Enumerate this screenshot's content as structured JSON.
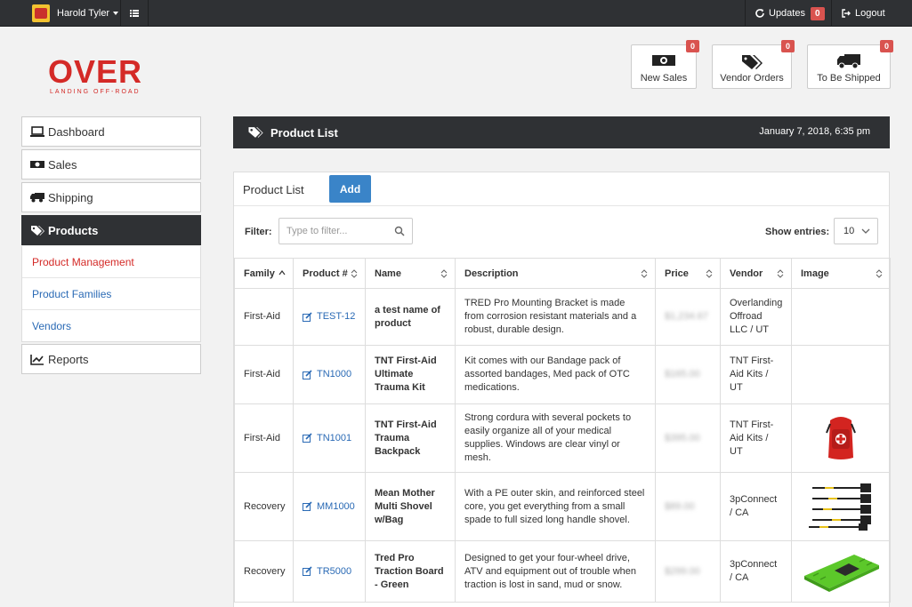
{
  "topbar": {
    "user_name": "Harold Tyler",
    "updates_label": "Updates",
    "updates_count": "0",
    "logout_label": "Logout"
  },
  "logo": {
    "main": "OVER",
    "sub": "LANDING OFF-ROAD"
  },
  "stats": [
    {
      "label": "New Sales",
      "count": "0",
      "icon": "money-icon"
    },
    {
      "label": "Vendor Orders",
      "count": "0",
      "icon": "tags-icon"
    },
    {
      "label": "To Be Shipped",
      "count": "0",
      "icon": "truck-icon"
    }
  ],
  "sidebar": {
    "items": [
      {
        "label": "Dashboard",
        "icon": "laptop-icon"
      },
      {
        "label": "Sales",
        "icon": "money-icon"
      },
      {
        "label": "Shipping",
        "icon": "truck-icon"
      },
      {
        "label": "Products",
        "icon": "tags-icon"
      },
      {
        "label": "Reports",
        "icon": "chart-icon"
      }
    ],
    "sub_items": [
      {
        "label": "Product Management",
        "color": "#d42a27"
      },
      {
        "label": "Product Families",
        "color": "#2a6ab5"
      },
      {
        "label": "Vendors",
        "color": "#2a6ab5"
      }
    ]
  },
  "header": {
    "title": "Product List",
    "date": "January 7, 2018, 6:35 pm"
  },
  "list": {
    "title": "Product List",
    "add_label": "Add",
    "filter_label": "Filter:",
    "filter_placeholder": "Type to filter...",
    "entries_label": "Show entries:",
    "entries_value": "10",
    "columns": [
      "Family",
      "Product #",
      "Name",
      "Description",
      "Price",
      "Vendor",
      "Image"
    ],
    "rows": [
      {
        "family": "First-Aid",
        "product": "TEST-12",
        "name": "a test name of product",
        "description": "TRED Pro Mounting Bracket is made from corrosion resistant materials and a robust, durable design.",
        "price": "$1,234.67",
        "vendor": "Overlanding Offroad LLC / UT",
        "image": ""
      },
      {
        "family": "First-Aid",
        "product": "TN1000",
        "name": "TNT First-Aid Ultimate Trauma Kit",
        "description": "Kit comes with our Bandage pack of assorted bandages, Med pack of OTC medications.",
        "price": "$165.00",
        "vendor": "TNT First-Aid Kits / UT",
        "image": ""
      },
      {
        "family": "First-Aid",
        "product": "TN1001",
        "name": "TNT First-Aid Trauma Backpack",
        "description": "Strong cordura with several pockets to easily organize all of your medical supplies. Windows are clear vinyl or mesh.",
        "price": "$395.00",
        "vendor": "TNT First-Aid Kits / UT",
        "image": "backpack"
      },
      {
        "family": "Recovery",
        "product": "MM1000",
        "name": "Mean Mother Multi Shovel w/Bag",
        "description": "With a PE outer skin, and reinforced steel core, you get everything from a small spade to full sized long handle shovel.",
        "price": "$89.00",
        "vendor": "3pConnect / CA",
        "image": "shovel"
      },
      {
        "family": "Recovery",
        "product": "TR5000",
        "name": "Tred Pro Traction Board - Green",
        "description": "Designed to get your four-wheel drive, ATV and equipment out of trouble when traction is lost in sand, mud or snow.",
        "price": "$299.00",
        "vendor": "3pConnect / CA",
        "image": "traction-board"
      }
    ]
  }
}
